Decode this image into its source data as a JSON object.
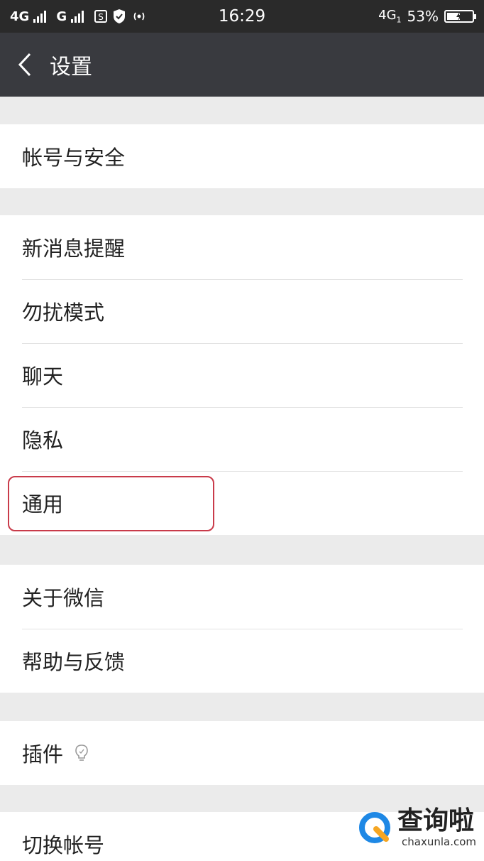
{
  "status_bar": {
    "network1": "4G",
    "network2": "G",
    "time": "16:29",
    "right_network": "4G",
    "right_network_sub": "1",
    "battery_percent_label": "53%",
    "battery_level": 0.53
  },
  "nav": {
    "title": "设置",
    "back_icon": "chevron-left-icon"
  },
  "groups": {
    "account": {
      "items": [
        "帐号与安全"
      ]
    },
    "main": {
      "items": [
        "新消息提醒",
        "勿扰模式",
        "聊天",
        "隐私",
        "通用"
      ]
    },
    "about": {
      "items": [
        "关于微信",
        "帮助与反馈"
      ]
    },
    "plugins": {
      "items": [
        "插件"
      ],
      "icon": "lightbulb-icon"
    },
    "switch": {
      "items": [
        "切换帐号"
      ]
    }
  },
  "highlighted_item": "通用",
  "colors": {
    "status_bar_bg": "#2a2a2a",
    "nav_bg": "#393a3f",
    "page_bg": "#ebebeb",
    "highlight_border": "#c93b4a",
    "watermark_blue": "#1e88e5",
    "watermark_orange": "#f5a623"
  },
  "watermark": {
    "cn": "查询啦",
    "en": "chaxunla.com"
  }
}
